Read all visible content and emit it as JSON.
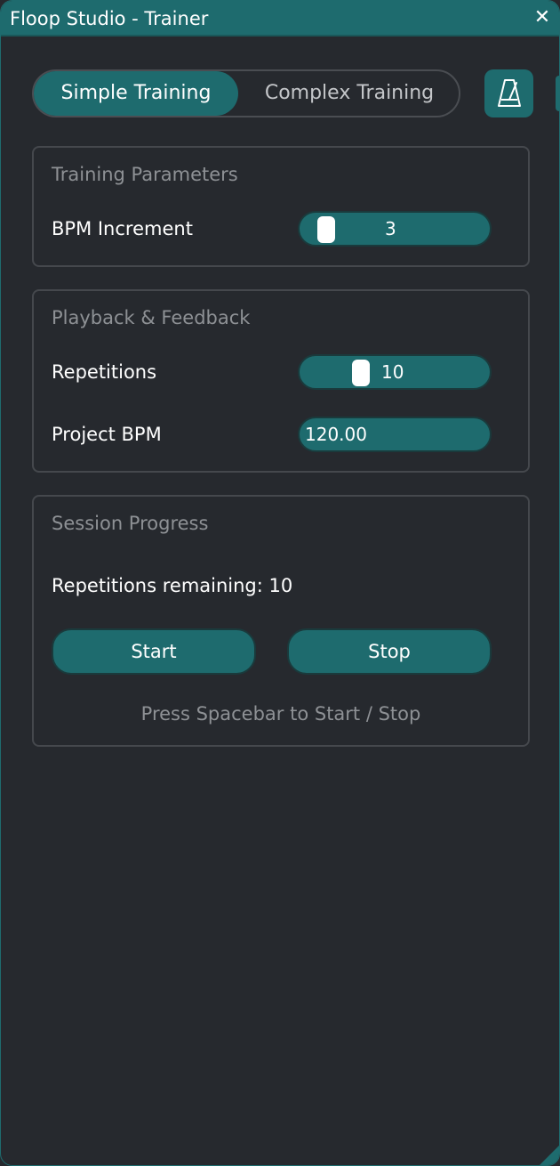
{
  "window": {
    "title": "Floop Studio - Trainer",
    "close_glyph": "✕",
    "accent_color": "#1e6b6e",
    "background_color": "#26292e"
  },
  "tabs": [
    {
      "label": "Simple Training",
      "active": true
    },
    {
      "label": "Complex Training",
      "active": false
    }
  ],
  "toolbar": {
    "metronome_icon": "metronome-icon"
  },
  "training_parameters": {
    "title": "Training Parameters",
    "bpm_increment_label": "BPM Increment",
    "bpm_increment_value": "3"
  },
  "playback": {
    "title": "Playback & Feedback",
    "repetitions_label": "Repetitions",
    "repetitions_value": "10",
    "project_bpm_label": "Project BPM",
    "project_bpm_value": "120.00"
  },
  "session": {
    "title": "Session Progress",
    "remaining_text": "Repetitions remaining: 10",
    "start_label": "Start",
    "stop_label": "Stop",
    "hint": "Press Spacebar to Start / Stop"
  }
}
